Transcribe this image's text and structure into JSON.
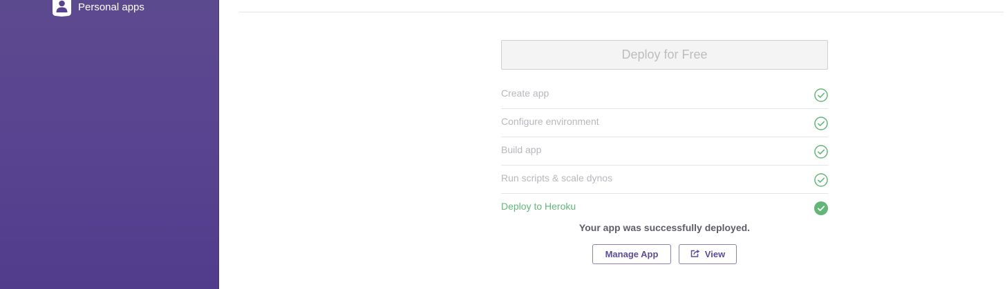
{
  "sidebar": {
    "item": {
      "label": "Personal apps",
      "icon": "user-icon"
    },
    "colors": {
      "background": "#584390",
      "text": "#ffffff"
    }
  },
  "deploy": {
    "button_label": "Deploy for Free",
    "steps": [
      {
        "label": "Create app",
        "status": "done"
      },
      {
        "label": "Configure environment",
        "status": "done"
      },
      {
        "label": "Build app",
        "status": "done"
      },
      {
        "label": "Run scripts & scale dynos",
        "status": "done"
      },
      {
        "label": "Deploy to Heroku",
        "status": "complete"
      }
    ],
    "success_message": "Your app was successfully deployed.",
    "actions": {
      "manage_label": "Manage App",
      "view_label": "View",
      "view_icon": "external-link-icon"
    },
    "colors": {
      "success": "#62b678",
      "accent": "#5e4b98",
      "muted": "#b7b7bd"
    }
  }
}
